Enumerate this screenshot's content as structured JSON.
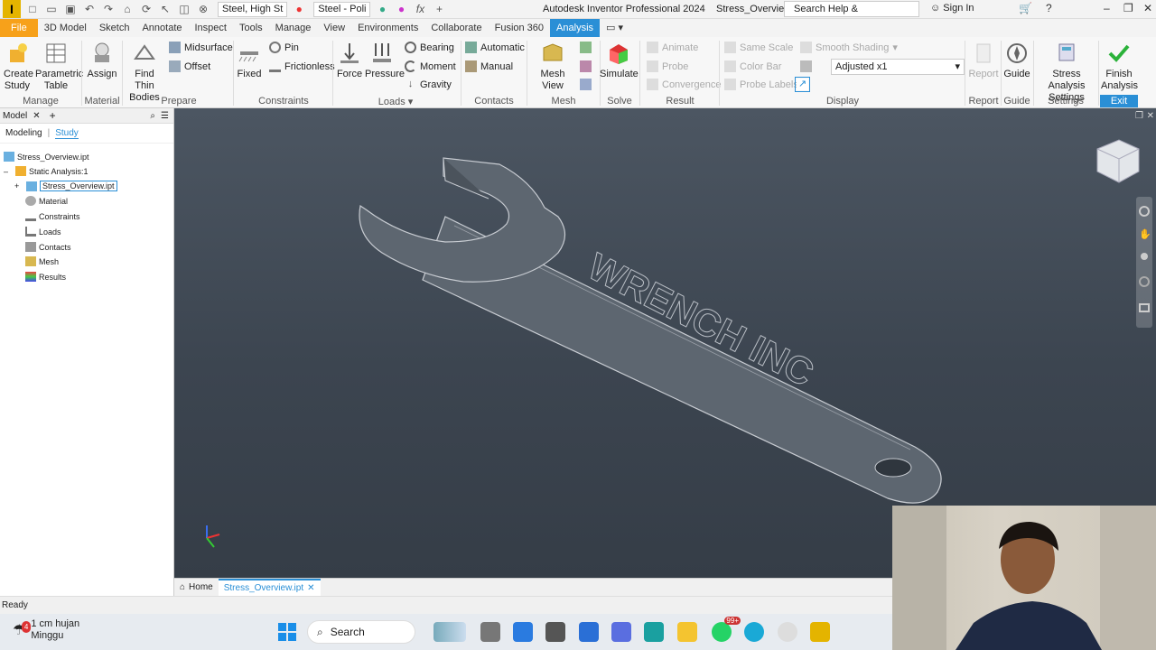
{
  "titlebar": {
    "app_icon_letter": "I",
    "material_select": "Steel, High St",
    "appearance_select": "Steel - Poli",
    "window_title": "Autodesk Inventor Professional 2024",
    "document_title": "Stress_Overview",
    "search_placeholder": "Search Help & Commands...",
    "signin": "Sign In"
  },
  "tabs": [
    "File",
    "3D Model",
    "Sketch",
    "Annotate",
    "Inspect",
    "Tools",
    "Manage",
    "View",
    "Environments",
    "Collaborate",
    "Fusion 360",
    "Analysis"
  ],
  "ribbon": {
    "manage": {
      "create_study": "Create Study",
      "parametric_table": "Parametric Table",
      "label": "Manage"
    },
    "material": {
      "assign": "Assign",
      "label": "Material"
    },
    "prepare": {
      "find_thin_bodies": "Find Thin Bodies",
      "midsurface": "Midsurface",
      "offset": "Offset",
      "label": "Prepare"
    },
    "constraints": {
      "fixed": "Fixed",
      "pin": "Pin",
      "frictionless": "Frictionless",
      "label": "Constraints"
    },
    "loads": {
      "force": "Force",
      "pressure": "Pressure",
      "bearing": "Bearing",
      "moment": "Moment",
      "gravity": "Gravity",
      "label": "Loads"
    },
    "contacts": {
      "automatic": "Automatic",
      "manual": "Manual",
      "label": "Contacts"
    },
    "mesh": {
      "mesh_view": "Mesh View",
      "label": "Mesh"
    },
    "solve": {
      "simulate": "Simulate",
      "label": "Solve"
    },
    "result": {
      "animate": "Animate",
      "probe": "Probe",
      "convergence": "Convergence",
      "label": "Result"
    },
    "display": {
      "same_scale": "Same Scale",
      "color_bar": "Color Bar",
      "probe_labels": "Probe Labels",
      "smooth_shading": "Smooth Shading",
      "adjusted": "Adjusted x1",
      "label": "Display"
    },
    "report": {
      "report": "Report",
      "label": "Report"
    },
    "guide": {
      "guide": "Guide",
      "label": "Guide"
    },
    "settings": {
      "stress_analysis_settings": "Stress Analysis Settings",
      "label": "Settings"
    },
    "exit": {
      "finish_analysis": "Finish Analysis",
      "label": "Exit"
    }
  },
  "browser": {
    "tab_model": "Model",
    "modeling": "Modeling",
    "study": "Study",
    "tree": {
      "root": "Stress_Overview.ipt",
      "analysis": "Static Analysis:1",
      "part": "Stress_Overview.ipt",
      "material": "Material",
      "constraints": "Constraints",
      "loads": "Loads",
      "contacts": "Contacts",
      "mesh": "Mesh",
      "results": "Results"
    }
  },
  "viewport": {
    "engraving": "WRENCH INC"
  },
  "doc_tabs": {
    "home": "Home",
    "active": "Stress_Overview.ipt"
  },
  "status": "Ready",
  "taskbar": {
    "weather_temp": "1 cm hujan",
    "weather_day": "Minggu",
    "weather_badge": "4",
    "search": "Search",
    "badge_count": "99+"
  },
  "colors": {
    "accent": "#2a8fd6",
    "file_tab": "#f7a11a",
    "viewport_bg": "#3c4550"
  }
}
